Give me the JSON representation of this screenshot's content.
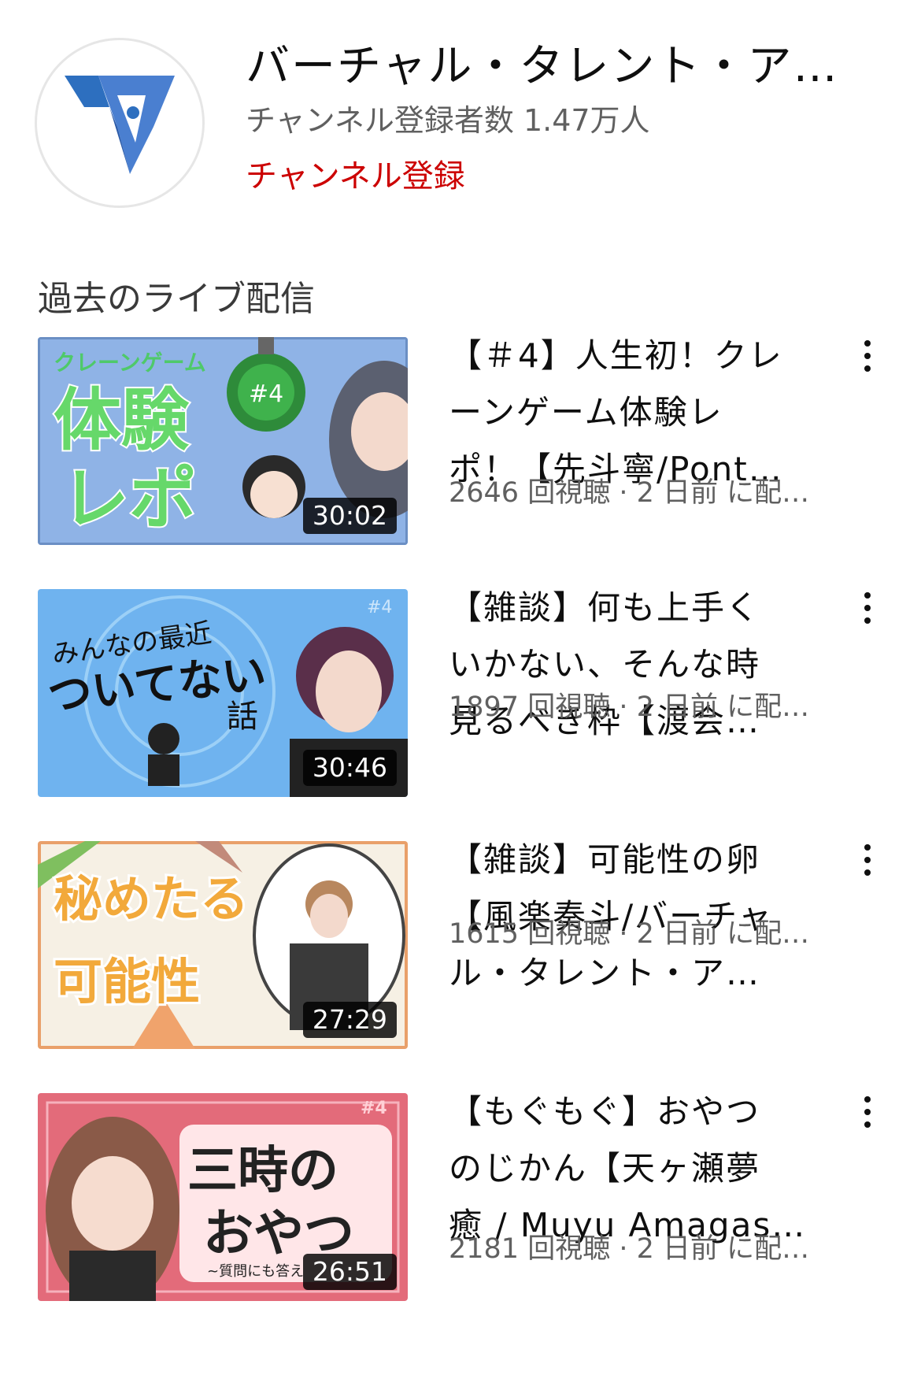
{
  "channel": {
    "name": "バーチャル・タレント・ア…",
    "subscribers": "チャンネル登録者数 1.47万人",
    "subscribe_label": "チャンネル登録"
  },
  "section": {
    "title": "過去のライブ配信"
  },
  "videos": [
    {
      "title_lines": [
        "【＃4】人生初！クレ",
        "ーンゲーム体験レ",
        "ポ！【先斗寧/Pont…"
      ],
      "meta": "2646 回視聴 · 2 日前 に配…",
      "duration": "30:02",
      "thumb_text": [
        "クレーンゲーム",
        "体験",
        "レポ",
        "#4"
      ]
    },
    {
      "title_lines": [
        "【雑談】何も上手く",
        "いかない、そんな時",
        "見るべき枠【渡会…"
      ],
      "meta": "1897 回視聴 · 2 日前 に配…",
      "duration": "30:46",
      "thumb_text": [
        "みんなの最近",
        "ついてない",
        "話",
        "#4"
      ]
    },
    {
      "title_lines": [
        "【雑談】可能性の卵",
        "【風楽奏斗/バーチャ",
        "ル・タレント・ア…"
      ],
      "meta": "1615 回視聴 · 2 日前 に配…",
      "duration": "27:29",
      "thumb_text": [
        "秘めたる",
        "可能性"
      ]
    },
    {
      "title_lines": [
        "【もぐもぐ】おやつ",
        "のじかん【天ヶ瀬夢",
        "癒 / Muyu Amagase…"
      ],
      "meta": "2181 回視聴 · 2 日前 に配…",
      "duration": "26:51",
      "thumb_text": [
        "三時の",
        "おやつ",
        "~質問にも答え",
        "#4"
      ]
    }
  ]
}
